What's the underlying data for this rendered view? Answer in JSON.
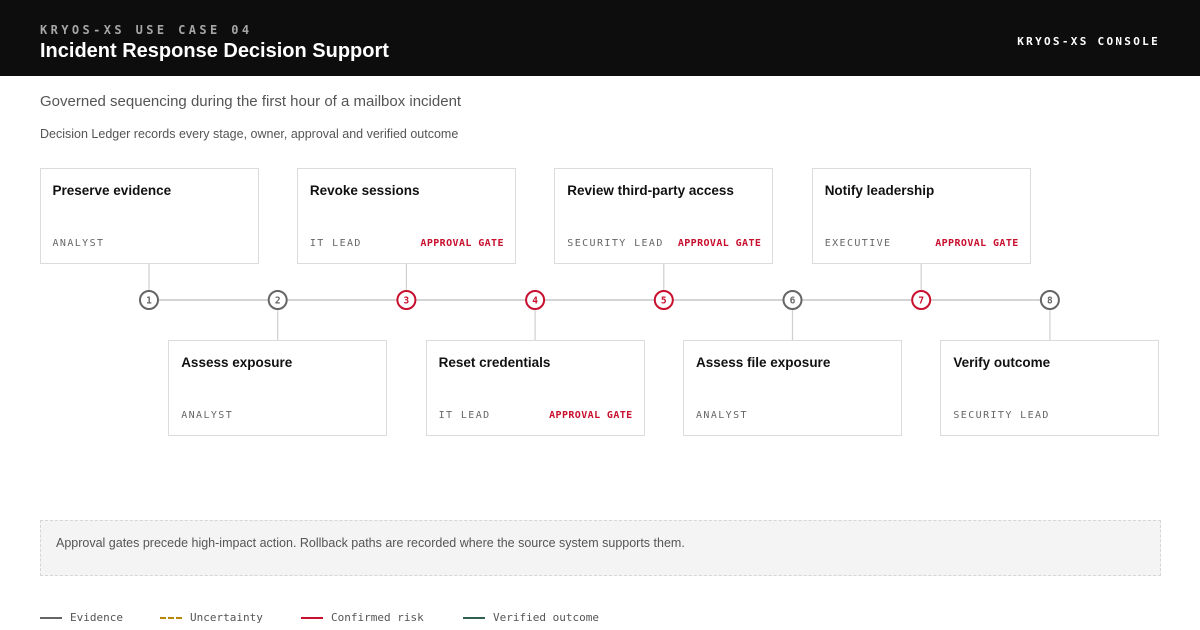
{
  "header": {
    "eyebrow": "KRYOS-XS USE CASE 04",
    "title": "Incident Response Decision Support",
    "console_label": "KRYOS-XS CONSOLE"
  },
  "subtitle": "Governed sequencing during the first hour of a mailbox incident",
  "note": "Decision Ledger records every stage, owner, approval and verified outcome",
  "steps": [
    {
      "number": "1",
      "title": "Preserve evidence",
      "owner": "ANALYST",
      "gate": "",
      "position": "top",
      "status": "neutral"
    },
    {
      "number": "2",
      "title": "Assess exposure",
      "owner": "ANALYST",
      "gate": "",
      "position": "bottom",
      "status": "neutral"
    },
    {
      "number": "3",
      "title": "Revoke sessions",
      "owner": "IT LEAD",
      "gate": "APPROVAL GATE",
      "position": "top",
      "status": "risk"
    },
    {
      "number": "4",
      "title": "Reset credentials",
      "owner": "IT LEAD",
      "gate": "APPROVAL GATE",
      "position": "bottom",
      "status": "risk"
    },
    {
      "number": "5",
      "title": "Review third-party access",
      "owner": "SECURITY LEAD",
      "gate": "APPROVAL GATE",
      "position": "top",
      "status": "risk"
    },
    {
      "number": "6",
      "title": "Assess file exposure",
      "owner": "ANALYST",
      "gate": "",
      "position": "bottom",
      "status": "neutral"
    },
    {
      "number": "7",
      "title": "Notify leadership",
      "owner": "EXECUTIVE",
      "gate": "APPROVAL GATE",
      "position": "top",
      "status": "risk"
    },
    {
      "number": "8",
      "title": "Verify outcome",
      "owner": "SECURITY LEAD",
      "gate": "",
      "position": "bottom",
      "status": "neutral"
    }
  ],
  "callout": "Approval gates precede high-impact action. Rollback paths are recorded where the source system supports them.",
  "legend": [
    {
      "label": "Evidence",
      "color": "#666666",
      "style": "solid"
    },
    {
      "label": "Uncertainty",
      "color": "#b8860b",
      "style": "dashed"
    },
    {
      "label": "Confirmed risk",
      "color": "#c8102e",
      "style": "solid"
    },
    {
      "label": "Verified outcome",
      "color": "#2f5f4f",
      "style": "solid"
    }
  ],
  "colors": {
    "neutral": "#666666",
    "risk": "#c8102e"
  }
}
